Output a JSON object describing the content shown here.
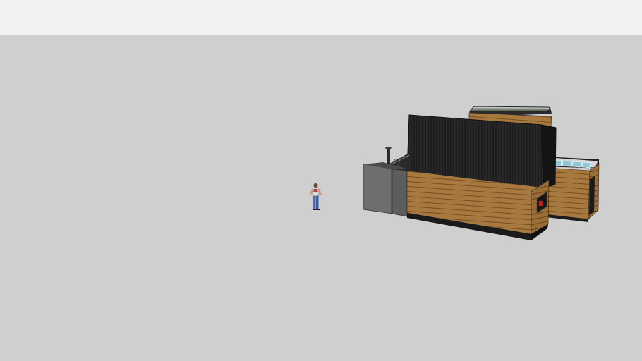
{
  "app": {
    "toolbar_icons": [],
    "viewport": {
      "background": "#cfcfcf",
      "scene_objects": [
        "scale-figure",
        "modular-building"
      ]
    }
  },
  "colors": {
    "toolbar_bg": "#f2f2f3",
    "viewport_bg": "#cfcfcf",
    "wood_cladding": "#a8793f",
    "black_panels": "#1c1c1c",
    "grey_module": "#6d6e6f",
    "glass_skylight": "#8ec8d6"
  }
}
